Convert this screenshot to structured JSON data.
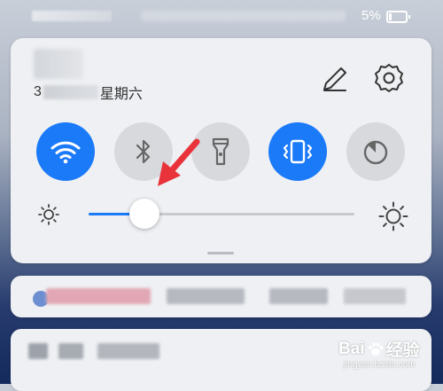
{
  "status_bar": {
    "battery_percent": "5%"
  },
  "header": {
    "date_prefix": "3",
    "weekday": "星期六"
  },
  "icons": {
    "edit": "pencil-icon",
    "settings": "gear-icon"
  },
  "toggles": [
    {
      "name": "wifi",
      "icon": "wifi-icon",
      "state": "on"
    },
    {
      "name": "bluetooth",
      "icon": "bluetooth-icon",
      "state": "off"
    },
    {
      "name": "flashlight",
      "icon": "flashlight-icon",
      "state": "off"
    },
    {
      "name": "vibration",
      "icon": "vibrate-icon",
      "state": "on"
    },
    {
      "name": "timer",
      "icon": "timer-icon",
      "state": "off"
    }
  ],
  "brightness": {
    "level": 0.21
  },
  "colors": {
    "accent": "#1a7af8",
    "panel": "#eef0f3",
    "toggle_off": "#d7d9dd",
    "annotation_arrow": "#e8333b"
  },
  "watermark": {
    "logo_left": "Bai",
    "logo_right": "经验",
    "url": "jingyan.baidu.com"
  }
}
